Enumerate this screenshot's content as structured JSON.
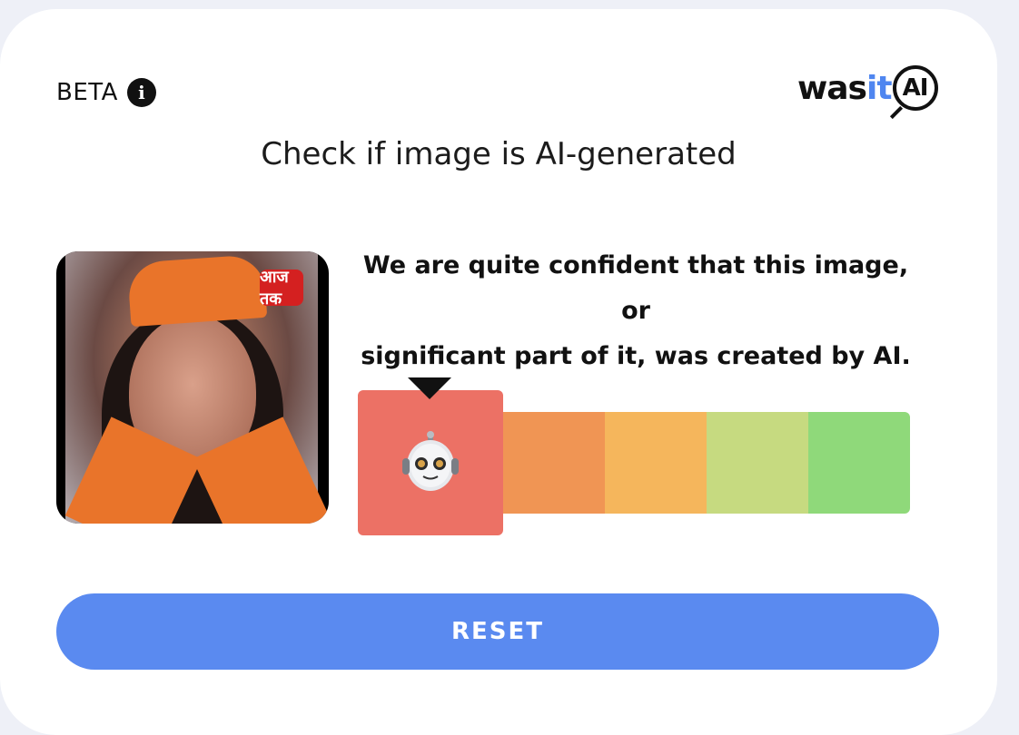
{
  "header": {
    "beta_label": "BETA",
    "info_icon": "info-icon",
    "logo": {
      "part_was": "was",
      "part_it": "it",
      "part_ai": "AI"
    }
  },
  "title": "Check if image is AI-generated",
  "image_badge_text": "आज तक",
  "result": {
    "line1": "We are quite confident that this image, or",
    "line2": "significant part of it, was created by AI.",
    "meter": {
      "selected_index": 0,
      "selected_icon": "robot-icon",
      "colors": [
        "#ec7165",
        "#f09554",
        "#f5b65c",
        "#c6da80",
        "#8fd97a"
      ]
    }
  },
  "actions": {
    "reset_label": "RESET"
  },
  "colors": {
    "accent": "#5a8af0",
    "logo_accent": "#4f86f0"
  }
}
